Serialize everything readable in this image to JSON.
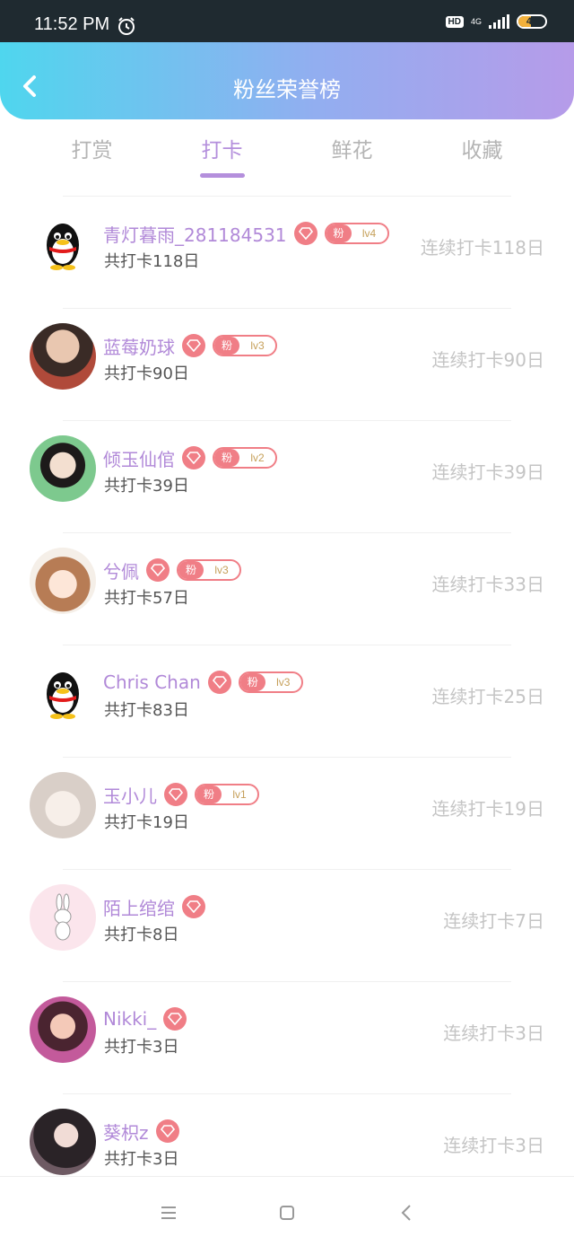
{
  "status_bar": {
    "time": "11:52 PM",
    "hd": "HD",
    "network": "4G",
    "battery_level": "46",
    "battery_fraction": 0.46,
    "icons": [
      "alarm-icon",
      "signal-icon",
      "battery-icon"
    ]
  },
  "header": {
    "title": "粉丝荣誉榜",
    "back_icon": "chevron-left-icon",
    "gradient_colors": [
      "#4fd6ee",
      "#b69be9"
    ]
  },
  "tabs": [
    {
      "label": "打赏",
      "active": false
    },
    {
      "label": "打卡",
      "active": true
    },
    {
      "label": "鲜花",
      "active": false
    },
    {
      "label": "收藏",
      "active": false
    }
  ],
  "accent_color": "#b48fdc",
  "badge_color": "#f07e86",
  "fans": [
    {
      "name": "青灯暮雨_281184531",
      "badge_label": "粉",
      "level": "lv4",
      "total": "共打卡118日",
      "streak": "连续打卡118日",
      "avatar": "penguin-avatar"
    },
    {
      "name": "蓝莓奶球",
      "badge_label": "粉",
      "level": "lv3",
      "total": "共打卡90日",
      "streak": "连续打卡90日",
      "avatar": "photo-avatar"
    },
    {
      "name": "倾玉仙倌",
      "badge_label": "粉",
      "level": "lv2",
      "total": "共打卡39日",
      "streak": "连续打卡39日",
      "avatar": "photo-avatar"
    },
    {
      "name": "兮佩",
      "badge_label": "粉",
      "level": "lv3",
      "total": "共打卡57日",
      "streak": "连续打卡33日",
      "avatar": "anime-avatar"
    },
    {
      "name": "Chris Chan",
      "badge_label": "粉",
      "level": "lv3",
      "total": "共打卡83日",
      "streak": "连续打卡25日",
      "avatar": "penguin-avatar"
    },
    {
      "name": "玉小儿",
      "badge_label": "粉",
      "level": "lv1",
      "total": "共打卡19日",
      "streak": "连续打卡19日",
      "avatar": "kitten-avatar"
    },
    {
      "name": "陌上绾绾",
      "total": "共打卡8日",
      "streak": "连续打卡7日",
      "avatar": "bunny-avatar"
    },
    {
      "name": "Nikki_",
      "total": "共打卡3日",
      "streak": "连续打卡3日",
      "avatar": "photo-avatar"
    },
    {
      "name": "葵枳z",
      "total": "共打卡3日",
      "streak": "连续打卡3日",
      "avatar": "drawing-avatar"
    }
  ],
  "nav_bar": {
    "buttons": [
      "menu-icon",
      "home-icon",
      "back-icon"
    ]
  }
}
